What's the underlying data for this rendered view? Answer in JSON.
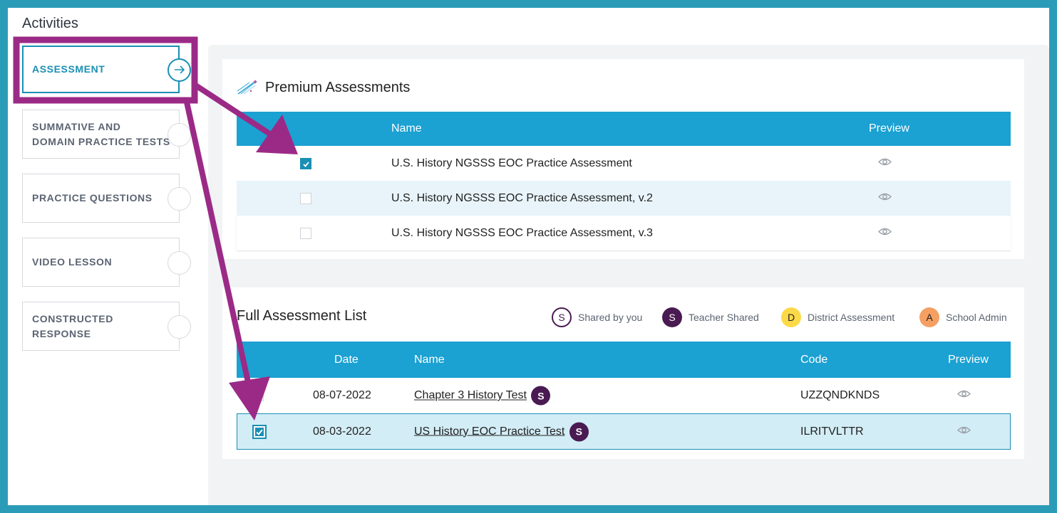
{
  "colors": {
    "frame_border": "#2b9cb8",
    "accent": "#1a8fb4",
    "table_header": "#1ba1d2",
    "annotation": "#9b2a87",
    "shared_badge": "#4a1a52",
    "district_badge": "#fcd948",
    "school_admin_badge": "#f5a062"
  },
  "sidebar": {
    "title": "Activities",
    "items": [
      {
        "label": "ASSESSMENT",
        "active": true,
        "icon": "arrow-right-icon"
      },
      {
        "label_lines": [
          "SUMMATIVE AND",
          "DOMAIN PRACTICE TESTS"
        ],
        "active": false
      },
      {
        "label": "PRACTICE QUESTIONS",
        "active": false
      },
      {
        "label": "VIDEO LESSON",
        "active": false
      },
      {
        "label_lines": [
          "CONSTRUCTED",
          "RESPONSE"
        ],
        "active": false
      }
    ]
  },
  "premium": {
    "title": "Premium Assessments",
    "icon": "shooting-star-icon",
    "columns": {
      "name": "Name",
      "preview": "Preview"
    },
    "rows": [
      {
        "name": "U.S. History NGSSS EOC Practice Assessment",
        "checked": true,
        "preview_icon": "eye-icon"
      },
      {
        "name": "U.S. History NGSSS EOC Practice Assessment, v.2",
        "checked": false,
        "preview_icon": "eye-icon"
      },
      {
        "name": "U.S. History NGSSS EOC Practice Assessment, v.3",
        "checked": false,
        "preview_icon": "eye-icon"
      }
    ]
  },
  "full_list": {
    "title": "Full Assessment List",
    "legend": [
      {
        "letter": "S",
        "label": "Shared by you",
        "style": "outline"
      },
      {
        "letter": "S",
        "label": "Teacher Shared",
        "style": "filled"
      },
      {
        "letter": "D",
        "label": "District Assessment",
        "style": "district"
      },
      {
        "letter": "A",
        "label": "School Admin",
        "style": "admin"
      }
    ],
    "columns": {
      "date": "Date",
      "name": "Name",
      "code": "Code",
      "preview": "Preview"
    },
    "rows": [
      {
        "date": "08-07-2022",
        "name": "Chapter 3 History Test",
        "badge": "S",
        "code": "UZZQNDKNDS",
        "checked": false,
        "selected": false
      },
      {
        "date": "08-03-2022",
        "name": "US History EOC Practice Test",
        "badge": "S",
        "code": "ILRITVLTTR",
        "checked": true,
        "selected": true
      }
    ]
  }
}
